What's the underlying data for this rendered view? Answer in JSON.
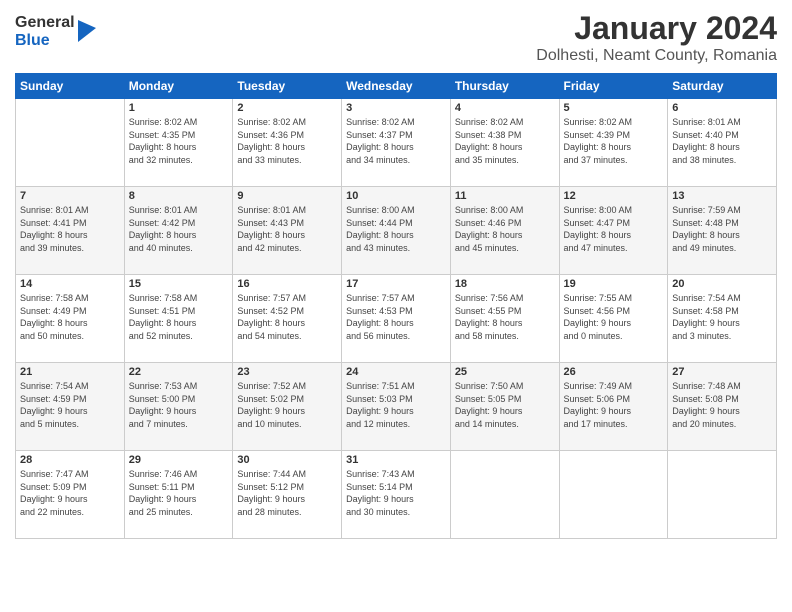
{
  "header": {
    "logo_general": "General",
    "logo_blue": "Blue",
    "title": "January 2024",
    "subtitle": "Dolhesti, Neamt County, Romania"
  },
  "days_of_week": [
    "Sunday",
    "Monday",
    "Tuesday",
    "Wednesday",
    "Thursday",
    "Friday",
    "Saturday"
  ],
  "weeks": [
    [
      {
        "day": "",
        "content": ""
      },
      {
        "day": "1",
        "content": "Sunrise: 8:02 AM\nSunset: 4:35 PM\nDaylight: 8 hours\nand 32 minutes."
      },
      {
        "day": "2",
        "content": "Sunrise: 8:02 AM\nSunset: 4:36 PM\nDaylight: 8 hours\nand 33 minutes."
      },
      {
        "day": "3",
        "content": "Sunrise: 8:02 AM\nSunset: 4:37 PM\nDaylight: 8 hours\nand 34 minutes."
      },
      {
        "day": "4",
        "content": "Sunrise: 8:02 AM\nSunset: 4:38 PM\nDaylight: 8 hours\nand 35 minutes."
      },
      {
        "day": "5",
        "content": "Sunrise: 8:02 AM\nSunset: 4:39 PM\nDaylight: 8 hours\nand 37 minutes."
      },
      {
        "day": "6",
        "content": "Sunrise: 8:01 AM\nSunset: 4:40 PM\nDaylight: 8 hours\nand 38 minutes."
      }
    ],
    [
      {
        "day": "7",
        "content": "Sunrise: 8:01 AM\nSunset: 4:41 PM\nDaylight: 8 hours\nand 39 minutes."
      },
      {
        "day": "8",
        "content": "Sunrise: 8:01 AM\nSunset: 4:42 PM\nDaylight: 8 hours\nand 40 minutes."
      },
      {
        "day": "9",
        "content": "Sunrise: 8:01 AM\nSunset: 4:43 PM\nDaylight: 8 hours\nand 42 minutes."
      },
      {
        "day": "10",
        "content": "Sunrise: 8:00 AM\nSunset: 4:44 PM\nDaylight: 8 hours\nand 43 minutes."
      },
      {
        "day": "11",
        "content": "Sunrise: 8:00 AM\nSunset: 4:46 PM\nDaylight: 8 hours\nand 45 minutes."
      },
      {
        "day": "12",
        "content": "Sunrise: 8:00 AM\nSunset: 4:47 PM\nDaylight: 8 hours\nand 47 minutes."
      },
      {
        "day": "13",
        "content": "Sunrise: 7:59 AM\nSunset: 4:48 PM\nDaylight: 8 hours\nand 49 minutes."
      }
    ],
    [
      {
        "day": "14",
        "content": "Sunrise: 7:58 AM\nSunset: 4:49 PM\nDaylight: 8 hours\nand 50 minutes."
      },
      {
        "day": "15",
        "content": "Sunrise: 7:58 AM\nSunset: 4:51 PM\nDaylight: 8 hours\nand 52 minutes."
      },
      {
        "day": "16",
        "content": "Sunrise: 7:57 AM\nSunset: 4:52 PM\nDaylight: 8 hours\nand 54 minutes."
      },
      {
        "day": "17",
        "content": "Sunrise: 7:57 AM\nSunset: 4:53 PM\nDaylight: 8 hours\nand 56 minutes."
      },
      {
        "day": "18",
        "content": "Sunrise: 7:56 AM\nSunset: 4:55 PM\nDaylight: 8 hours\nand 58 minutes."
      },
      {
        "day": "19",
        "content": "Sunrise: 7:55 AM\nSunset: 4:56 PM\nDaylight: 9 hours\nand 0 minutes."
      },
      {
        "day": "20",
        "content": "Sunrise: 7:54 AM\nSunset: 4:58 PM\nDaylight: 9 hours\nand 3 minutes."
      }
    ],
    [
      {
        "day": "21",
        "content": "Sunrise: 7:54 AM\nSunset: 4:59 PM\nDaylight: 9 hours\nand 5 minutes."
      },
      {
        "day": "22",
        "content": "Sunrise: 7:53 AM\nSunset: 5:00 PM\nDaylight: 9 hours\nand 7 minutes."
      },
      {
        "day": "23",
        "content": "Sunrise: 7:52 AM\nSunset: 5:02 PM\nDaylight: 9 hours\nand 10 minutes."
      },
      {
        "day": "24",
        "content": "Sunrise: 7:51 AM\nSunset: 5:03 PM\nDaylight: 9 hours\nand 12 minutes."
      },
      {
        "day": "25",
        "content": "Sunrise: 7:50 AM\nSunset: 5:05 PM\nDaylight: 9 hours\nand 14 minutes."
      },
      {
        "day": "26",
        "content": "Sunrise: 7:49 AM\nSunset: 5:06 PM\nDaylight: 9 hours\nand 17 minutes."
      },
      {
        "day": "27",
        "content": "Sunrise: 7:48 AM\nSunset: 5:08 PM\nDaylight: 9 hours\nand 20 minutes."
      }
    ],
    [
      {
        "day": "28",
        "content": "Sunrise: 7:47 AM\nSunset: 5:09 PM\nDaylight: 9 hours\nand 22 minutes."
      },
      {
        "day": "29",
        "content": "Sunrise: 7:46 AM\nSunset: 5:11 PM\nDaylight: 9 hours\nand 25 minutes."
      },
      {
        "day": "30",
        "content": "Sunrise: 7:44 AM\nSunset: 5:12 PM\nDaylight: 9 hours\nand 28 minutes."
      },
      {
        "day": "31",
        "content": "Sunrise: 7:43 AM\nSunset: 5:14 PM\nDaylight: 9 hours\nand 30 minutes."
      },
      {
        "day": "",
        "content": ""
      },
      {
        "day": "",
        "content": ""
      },
      {
        "day": "",
        "content": ""
      }
    ]
  ]
}
